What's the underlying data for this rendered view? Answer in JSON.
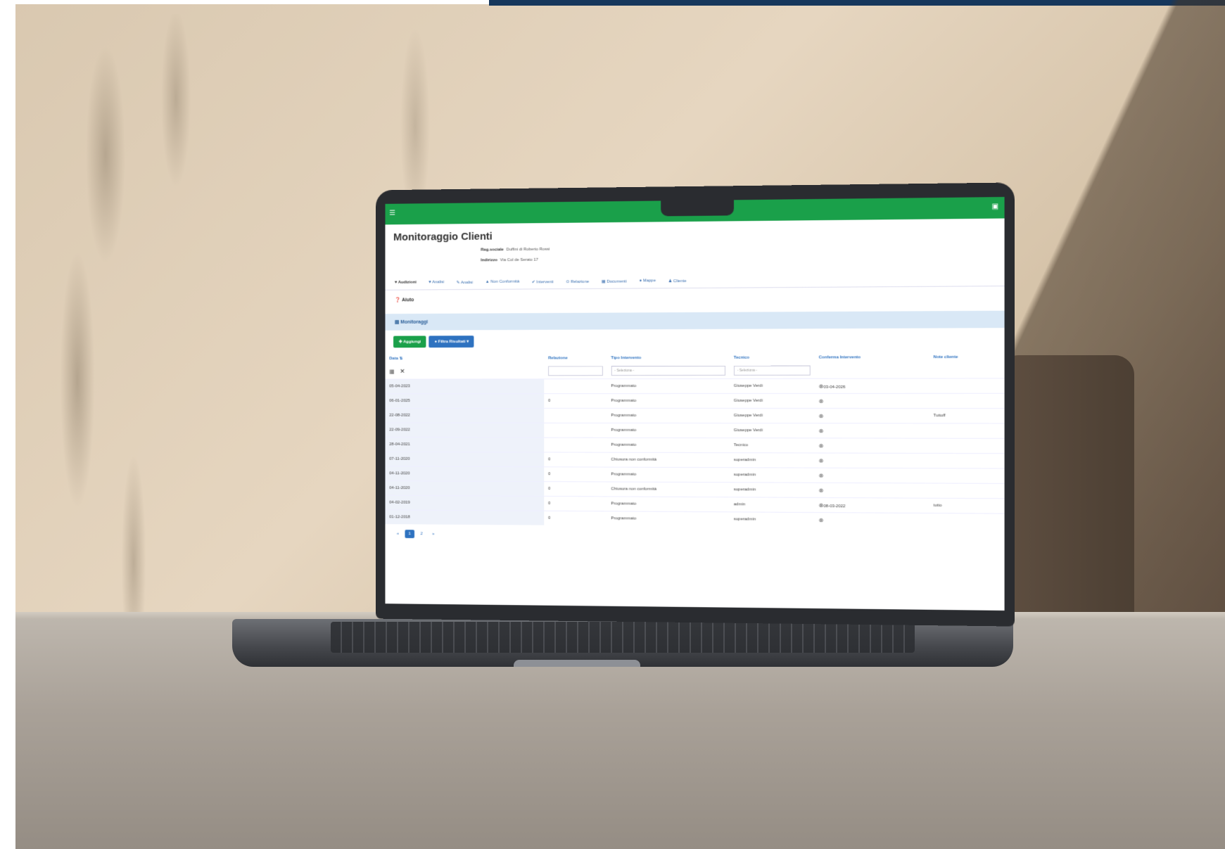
{
  "app": {
    "title": "Monitoraggio Clienti",
    "client": {
      "ragione_label": "Rag.sociale",
      "ragione_value": "Duffini di Roberto Rossi",
      "indirizzo_label": "Indirizzo",
      "indirizzo_value": "Via Col de Serato 17"
    },
    "tabs": [
      {
        "label": "Audizioni",
        "active": true
      },
      {
        "label": "Analisi"
      },
      {
        "label": "Analisi"
      },
      {
        "label": "Non Conformità"
      },
      {
        "label": "Interventi"
      },
      {
        "label": "Relazione"
      },
      {
        "label": "Documenti"
      },
      {
        "label": "Mappe"
      },
      {
        "label": "Cliente"
      }
    ],
    "help_label": "Aiuto",
    "section_label": "Monitoraggi",
    "buttons": {
      "add": "Aggiungi",
      "filter": "Filtra Risultati"
    },
    "columns": {
      "data": "Data",
      "relazione": "Relazione",
      "tipo": "Tipo Intervento",
      "tecnico": "Tecnico",
      "conferma": "Conferma Intervento",
      "note": "Note cliente"
    },
    "filters": {
      "tipo_placeholder": "- Seleziona -",
      "tecnico_placeholder": "- Seleziona -"
    },
    "rows": [
      {
        "data": "05-04-2023",
        "rel": "",
        "tipo": "Programmato",
        "tecnico": "Giuseppe Verdi",
        "conf": "03-04-2026",
        "note": ""
      },
      {
        "data": "06-01-2025",
        "rel": "0",
        "tipo": "Programmato",
        "tecnico": "Giuseppe Verdi",
        "conf": "",
        "note": ""
      },
      {
        "data": "22-08-2022",
        "rel": "",
        "tipo": "Programmato",
        "tecnico": "Giuseppe Verdi",
        "conf": "",
        "note": "Tuttoff"
      },
      {
        "data": "22-09-2022",
        "rel": "",
        "tipo": "Programmato",
        "tecnico": "Giuseppe Verdi",
        "conf": "",
        "note": ""
      },
      {
        "data": "28-04-2021",
        "rel": "",
        "tipo": "Programmato",
        "tecnico": "Tecnico",
        "conf": "",
        "note": ""
      },
      {
        "data": "07-11-2020",
        "rel": "0",
        "tipo": "Chiusura non conformità",
        "tecnico": "superadmin",
        "conf": "",
        "note": ""
      },
      {
        "data": "04-11-2020",
        "rel": "0",
        "tipo": "Programmato",
        "tecnico": "superadmin",
        "conf": "",
        "note": ""
      },
      {
        "data": "04-11-2020",
        "rel": "0",
        "tipo": "Chiusura non conformità",
        "tecnico": "superadmin",
        "conf": "",
        "note": ""
      },
      {
        "data": "04-02-2019",
        "rel": "0",
        "tipo": "Programmato",
        "tecnico": "admin",
        "conf": "08-03-2022",
        "note": "tutto"
      },
      {
        "data": "01-12-2018",
        "rel": "0",
        "tipo": "Programmato",
        "tecnico": "superadmin",
        "conf": "",
        "note": ""
      }
    ],
    "pager": {
      "prev": "«",
      "page1": "1",
      "page2": "2",
      "next": "»"
    }
  },
  "colors": {
    "header_green": "#1aa04a",
    "link_blue": "#2e72c0",
    "top_strip": "#16375c"
  }
}
